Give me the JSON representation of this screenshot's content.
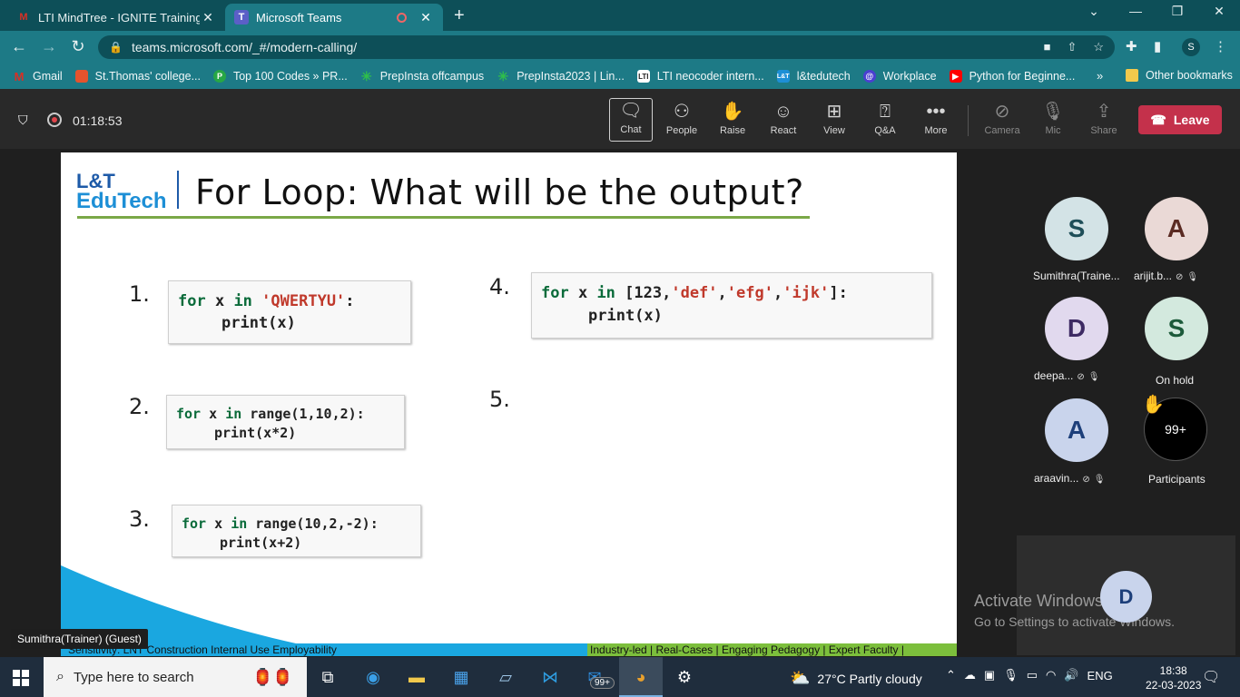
{
  "browser": {
    "tabs": [
      {
        "title": "LTI MindTree - IGNITE Training Pr",
        "favicon": "gmail-icon"
      },
      {
        "title": "Microsoft Teams",
        "favicon": "teams-icon"
      }
    ],
    "url": "teams.microsoft.com/_#/modern-calling/",
    "profile_initial": "S",
    "bookmarks": [
      {
        "label": "Gmail",
        "icon": "gmail-icon",
        "color": "#d93025"
      },
      {
        "label": "St.Thomas' college...",
        "icon": "college-icon",
        "color": "#e5532d"
      },
      {
        "label": "Top 100 Codes » PR...",
        "icon": "prepinsta-icon",
        "color": "#27a745"
      },
      {
        "label": "PrepInsta offcampus",
        "icon": "star-icon",
        "color": "#2fbf4a"
      },
      {
        "label": "PrepInsta2023 | Lin...",
        "icon": "star-icon",
        "color": "#2fbf4a"
      },
      {
        "label": "LTI neocoder intern...",
        "icon": "lti-icon",
        "color": "#222222"
      },
      {
        "label": "l&tedutech",
        "icon": "edutech-icon",
        "color": "#1d8fd6"
      },
      {
        "label": "Workplace",
        "icon": "workplace-icon",
        "color": "#4a3fd1"
      },
      {
        "label": "Python for Beginne...",
        "icon": "youtube-icon",
        "color": "#ff0000"
      }
    ],
    "bookmarks_more": "»",
    "other_bookmarks": "Other bookmarks"
  },
  "meeting": {
    "timer": "01:18:53",
    "controls": [
      {
        "label": "Chat",
        "icon": "chat-icon",
        "glyph": "💬"
      },
      {
        "label": "People",
        "icon": "people-icon",
        "glyph": "👥"
      },
      {
        "label": "Raise",
        "icon": "raise-hand-icon",
        "glyph": "✋"
      },
      {
        "label": "React",
        "icon": "react-icon",
        "glyph": "☺"
      },
      {
        "label": "View",
        "icon": "view-icon",
        "glyph": "⊞"
      },
      {
        "label": "Q&A",
        "icon": "qa-icon",
        "glyph": "?"
      },
      {
        "label": "More",
        "icon": "more-icon",
        "glyph": "•••"
      },
      {
        "label": "Camera",
        "icon": "camera-off-icon",
        "glyph": "⊘"
      },
      {
        "label": "Mic",
        "icon": "mic-off-icon",
        "glyph": "🎙"
      },
      {
        "label": "Share",
        "icon": "share-icon",
        "glyph": "⇪"
      }
    ],
    "leave_label": "Leave",
    "presenter_badge": "Sumithra(Trainer) (Guest)"
  },
  "slide": {
    "logo_top": "L&T",
    "logo_bottom": "EduTech",
    "title": "For Loop: What will be the output?",
    "questions": [
      {
        "num": "1.",
        "line1a": "for",
        "line1b": " x ",
        "line1c": "in",
        "line1d": " ",
        "line1e": "'QWERTYU'",
        "line1f": ":",
        "line2": "print(x)"
      },
      {
        "num": "2.",
        "line1a": "for",
        "line1b": " x ",
        "line1c": "in",
        "line1d": " range(1,10,2):",
        "line2": "print(x*2)"
      },
      {
        "num": "3.",
        "line1a": "for",
        "line1b": " x ",
        "line1c": "in",
        "line1d": " range(10,2,-2):",
        "line2": "print(x+2)"
      },
      {
        "num": "4.",
        "line1a": "for",
        "line1b": " x ",
        "line1c": "in",
        "line1d": " [123,",
        "line1e": "'def'",
        "line1f": ",",
        "line1g": "'efg'",
        "line1h": ",",
        "line1i": "'ijk'",
        "line1j": "]:",
        "line2": "print(x)"
      },
      {
        "num": "5."
      }
    ],
    "footer_left": "Sensitivity: LNT Construction Internal Use Employability",
    "footer_right": "Industry-led | Real-Cases | Engaging Pedagogy | Expert Faculty |"
  },
  "participants": [
    {
      "initial": "S",
      "name": "Sumithra(Traine...",
      "bg": "#d3e3e6",
      "fg": "#1e4e58"
    },
    {
      "initial": "A",
      "name": "arijit.b...",
      "bg": "#ead9d6",
      "fg": "#5a2a22"
    },
    {
      "initial": "D",
      "name": "deepa...",
      "bg": "#e1d9ee",
      "fg": "#3d2a63"
    },
    {
      "initial": "S",
      "name": "On hold",
      "bg": "#d3e9de",
      "fg": "#1c5a3a"
    },
    {
      "initial": "A",
      "name": "araavin...",
      "bg": "#c9d4ec",
      "fg": "#1d3f7a"
    }
  ],
  "participants_count": "99+",
  "participants_label": "Participants",
  "self_initial": "D",
  "activate": {
    "line1": "Activate Windows",
    "line2": "Go to Settings to activate Windows."
  },
  "taskbar": {
    "search_placeholder": "Type here to search",
    "mail_badge": "99+",
    "weather": "27°C  Partly cloudy",
    "lang": "ENG",
    "time": "18:38",
    "date": "22-03-2023"
  }
}
